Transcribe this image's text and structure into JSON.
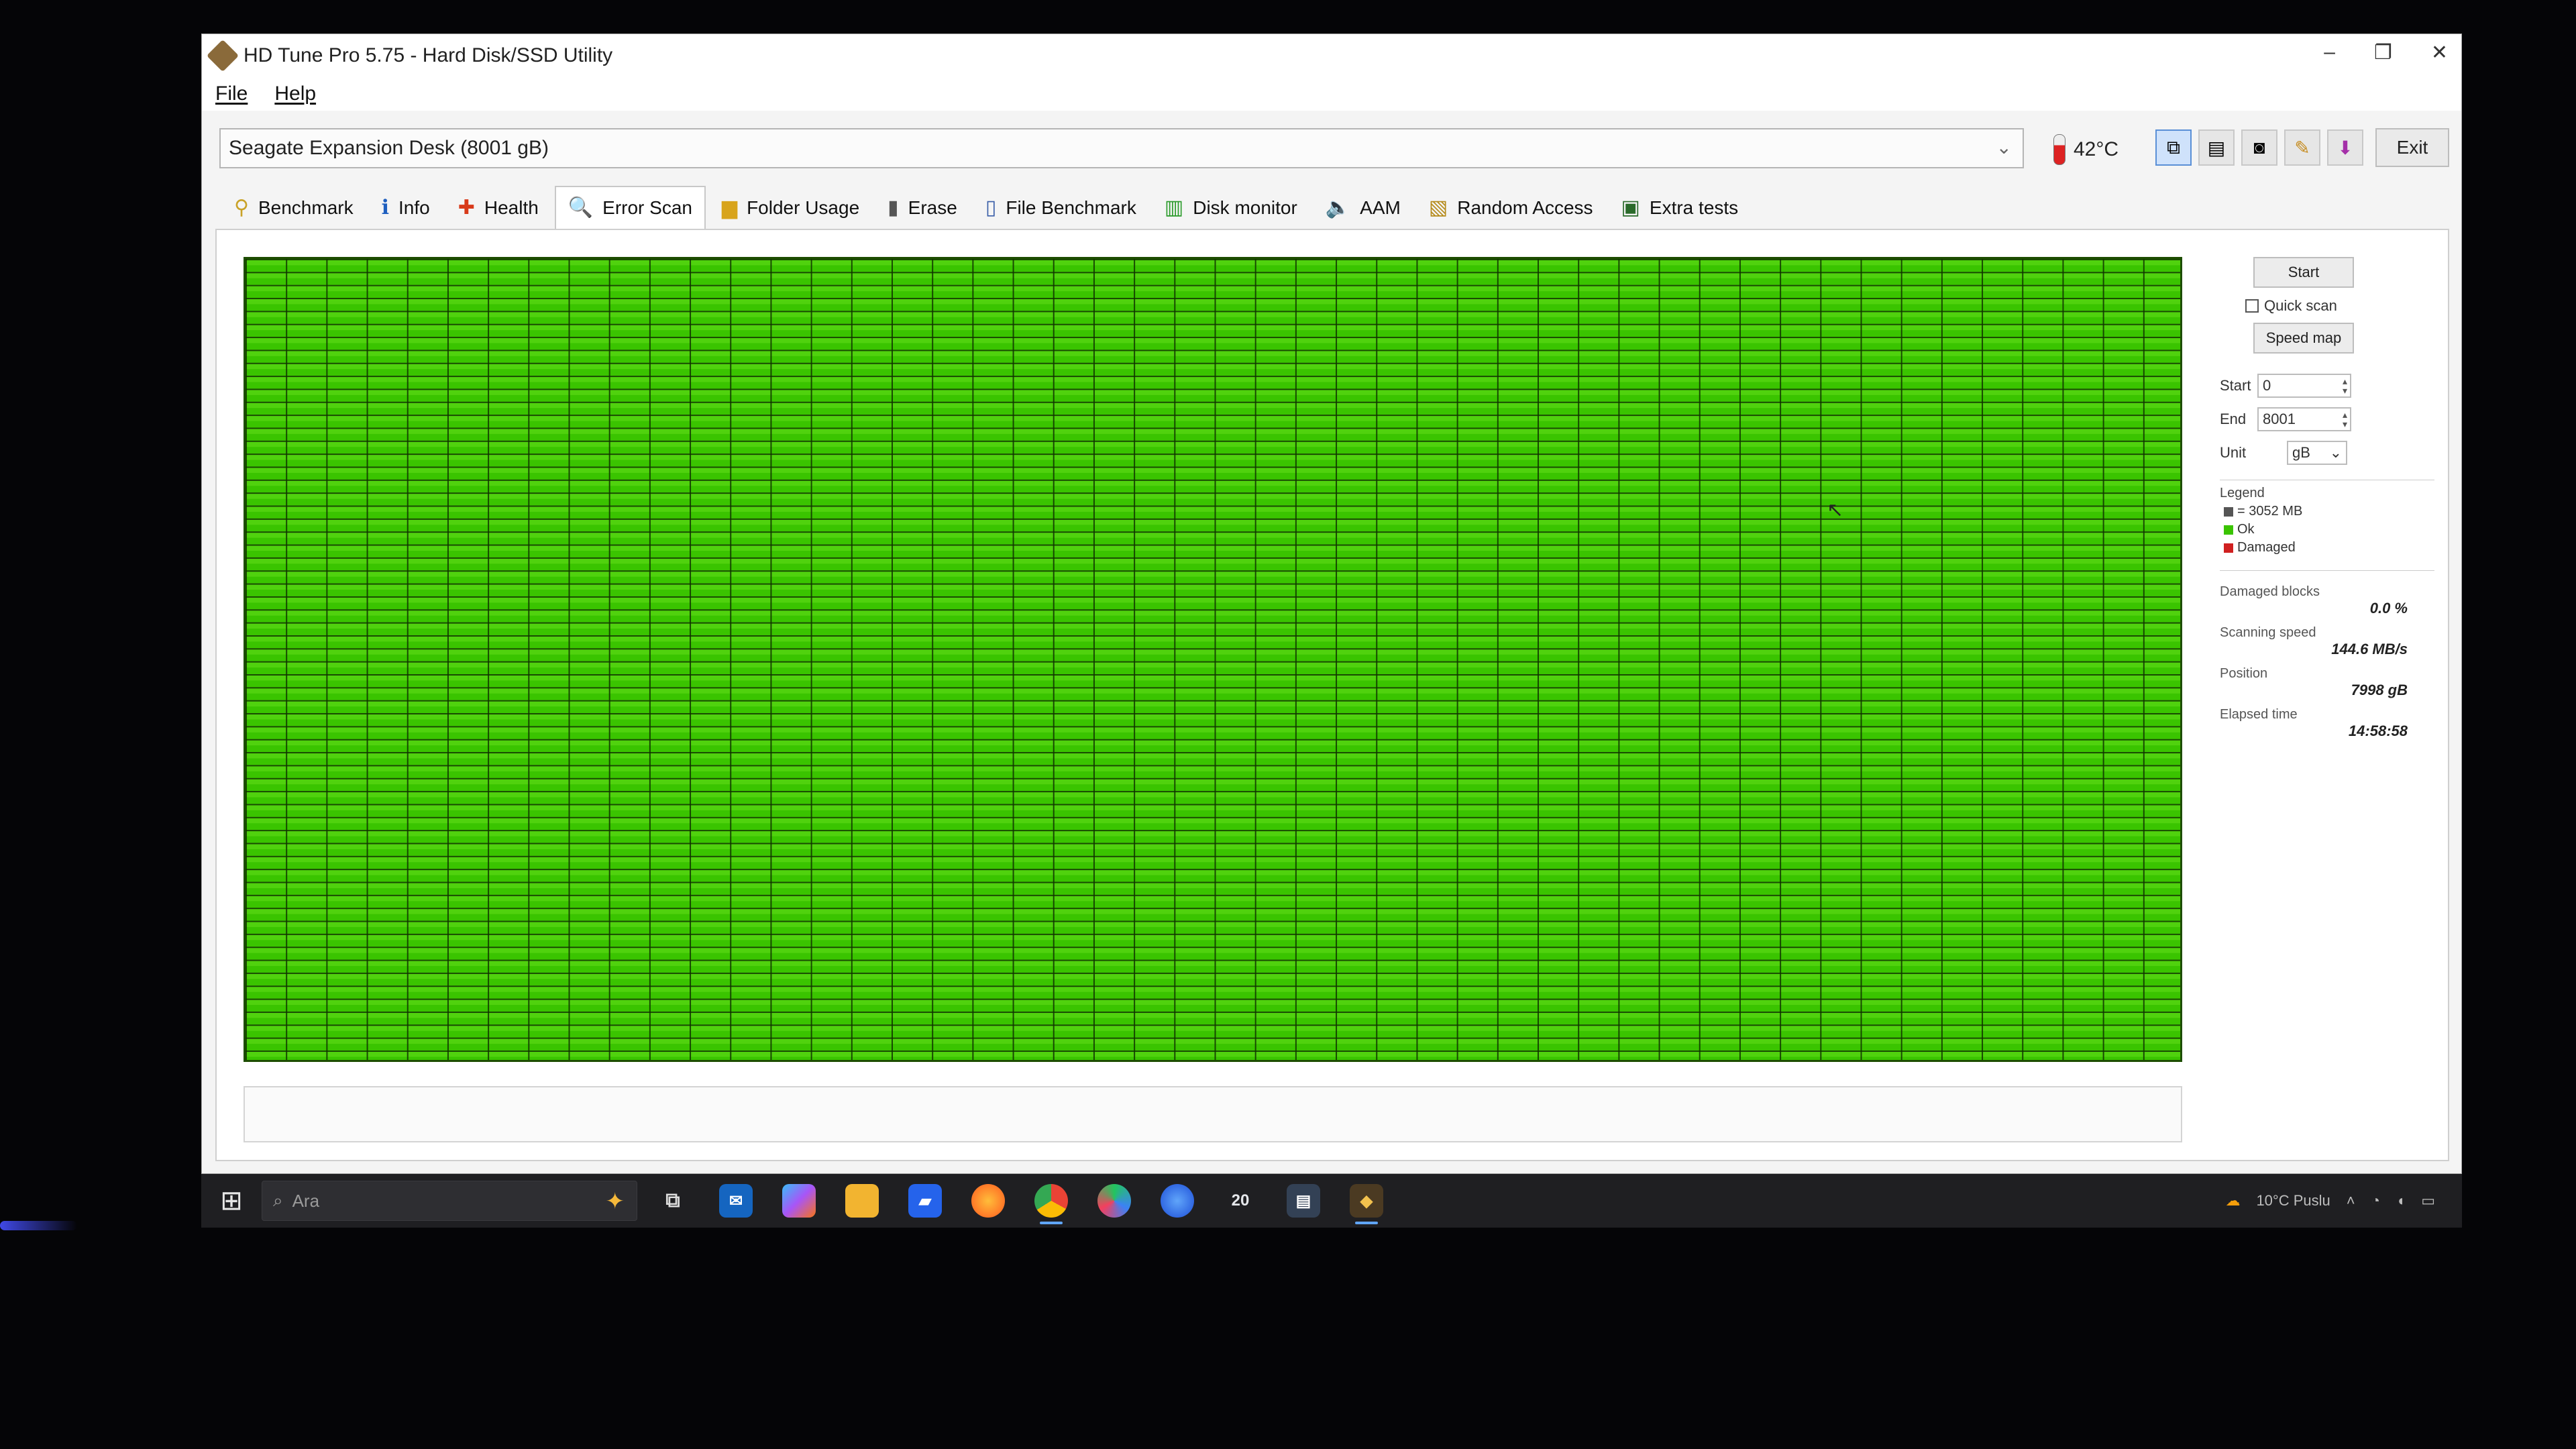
{
  "window": {
    "title": "HD Tune Pro 5.75 - Hard Disk/SSD Utility",
    "controls": [
      "–",
      "❐",
      "✕"
    ]
  },
  "menu": [
    "File",
    "Help"
  ],
  "drive": {
    "selected": "Seagate Expansion Desk (8001 gB)",
    "temperature": "42°C"
  },
  "toolbar": {
    "exit_label": "Exit"
  },
  "tabs": [
    {
      "label": "Benchmark",
      "icon": "benchmark-icon"
    },
    {
      "label": "Info",
      "icon": "info-icon"
    },
    {
      "label": "Health",
      "icon": "health-icon"
    },
    {
      "label": "Error Scan",
      "icon": "error-scan-icon"
    },
    {
      "label": "Folder Usage",
      "icon": "folder-icon"
    },
    {
      "label": "Erase",
      "icon": "erase-icon"
    },
    {
      "label": "File Benchmark",
      "icon": "file-benchmark-icon"
    },
    {
      "label": "Disk monitor",
      "icon": "disk-monitor-icon"
    },
    {
      "label": "AAM",
      "icon": "speaker-icon"
    },
    {
      "label": "Random Access",
      "icon": "random-access-icon"
    },
    {
      "label": "Extra tests",
      "icon": "extra-tests-icon"
    }
  ],
  "selected_tab": "Error Scan",
  "scan": {
    "start_button": "Start",
    "quick_scan_label": "Quick scan",
    "quick_scan_checked": false,
    "speed_map_button": "Speed map",
    "start_label": "Start",
    "start_value": "0",
    "end_label": "End",
    "end_value": "8001",
    "unit_label": "Unit",
    "unit_value": "gB",
    "legend_title": "Legend",
    "legend": [
      {
        "label": "= 3052 MB",
        "color": "#555555"
      },
      {
        "label": "Ok",
        "color": "#3ac400"
      },
      {
        "label": "Damaged",
        "color": "#d02020"
      }
    ],
    "damaged_blocks_label": "Damaged blocks",
    "damaged_blocks_value": "0.0 %",
    "scanning_speed_label": "Scanning speed",
    "scanning_speed_value": "144.6 MB/s",
    "position_label": "Position",
    "position_value": "7998 gB",
    "elapsed_label": "Elapsed time",
    "elapsed_value": "14:58:58",
    "block_color": "#3ac400"
  },
  "taskbar": {
    "search_placeholder": "Ara",
    "running_counter": "20",
    "weather": "10°C  Puslu"
  }
}
